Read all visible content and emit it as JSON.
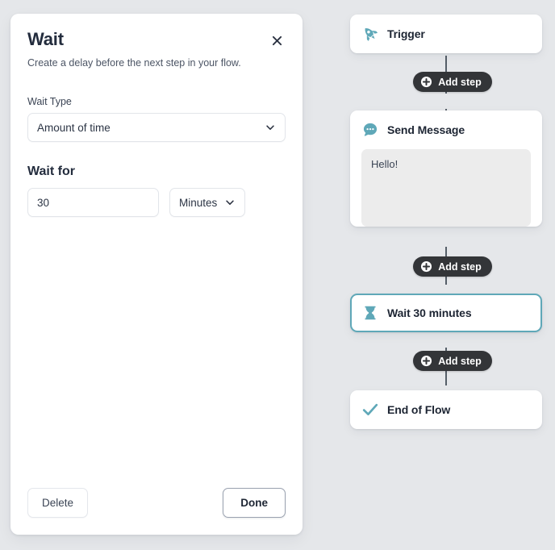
{
  "editor_panel": {
    "title": "Wait",
    "subtitle": "Create a delay before the next step in your flow.",
    "close_icon": "close-icon",
    "wait_type": {
      "label": "Wait Type",
      "value": "Amount of time",
      "chevron_icon": "chevron-down-icon"
    },
    "wait_for": {
      "section_title": "Wait for",
      "amount_value": "30",
      "unit_value": "Minutes",
      "chevron_icon": "chevron-down-icon"
    },
    "footer": {
      "delete_label": "Delete",
      "done_label": "Done"
    }
  },
  "flow": {
    "add_step_label": "Add step",
    "add_step_icon": "plus-circle-icon",
    "steps": [
      {
        "title": "Trigger",
        "icon": "rocket-icon",
        "selected": false
      },
      {
        "title": "Send Message",
        "icon": "chat-bubble-icon",
        "selected": false,
        "message": "Hello!"
      },
      {
        "title": "Wait 30 minutes",
        "icon": "hourglass-icon",
        "selected": true
      },
      {
        "title": "End of Flow",
        "icon": "check-icon",
        "selected": false
      }
    ]
  },
  "colors": {
    "accent_teal": "#5fa8b8",
    "canvas_background": "#e5e7ea",
    "pill_dark": "#333538",
    "connector": "#555e68"
  }
}
